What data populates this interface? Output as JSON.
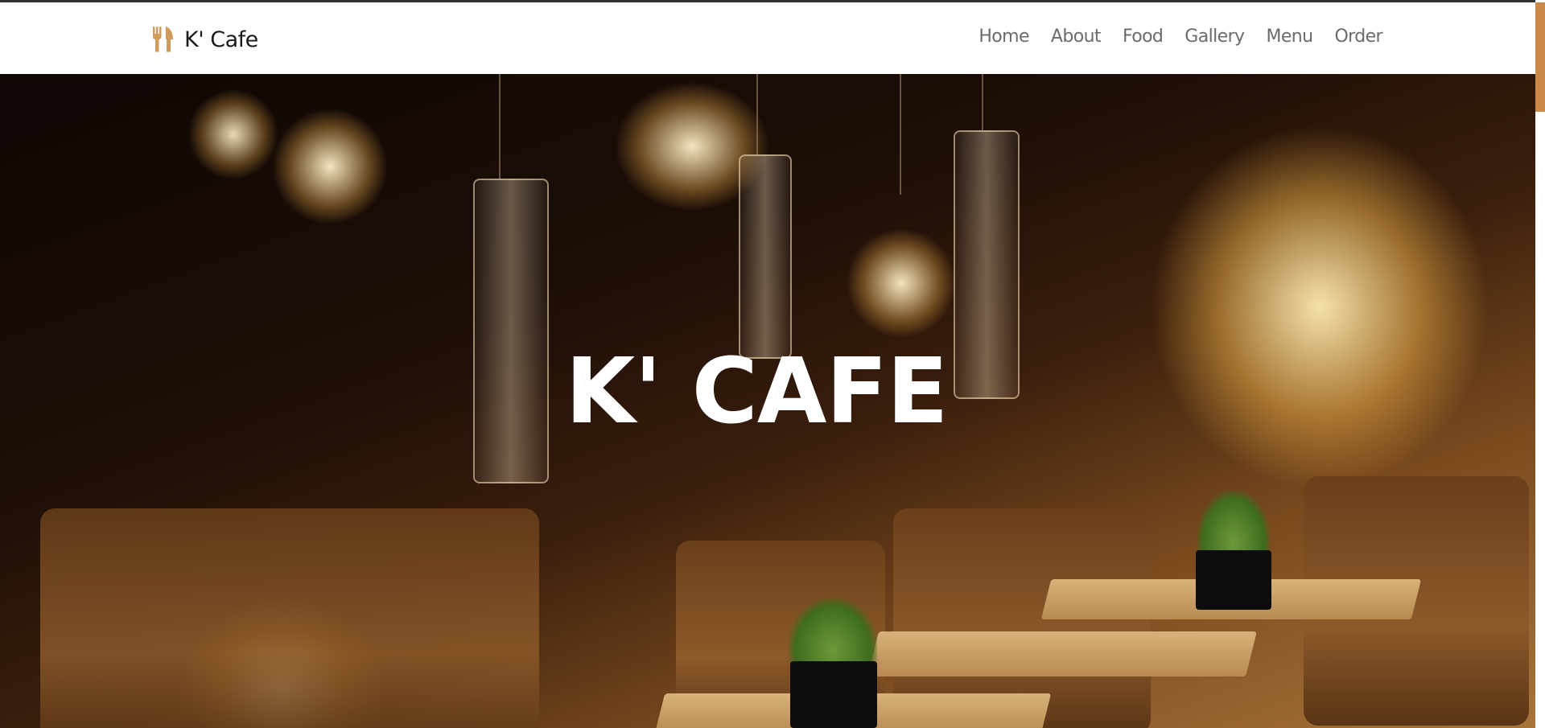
{
  "brand": {
    "name": "K' Cafe",
    "icon": "fork-knife-icon",
    "icon_color": "#d09a5a"
  },
  "nav": {
    "items": [
      {
        "label": "Home"
      },
      {
        "label": "About"
      },
      {
        "label": "Food"
      },
      {
        "label": "Gallery"
      },
      {
        "label": "Menu"
      },
      {
        "label": "Order"
      }
    ]
  },
  "hero": {
    "title": "K' CAFE",
    "background": "cafe-interior-pendant-lamps-photo"
  },
  "colors": {
    "accent": "#c8894a",
    "nav_text": "#6b6b6b",
    "brand_text": "#1a1a1a"
  }
}
